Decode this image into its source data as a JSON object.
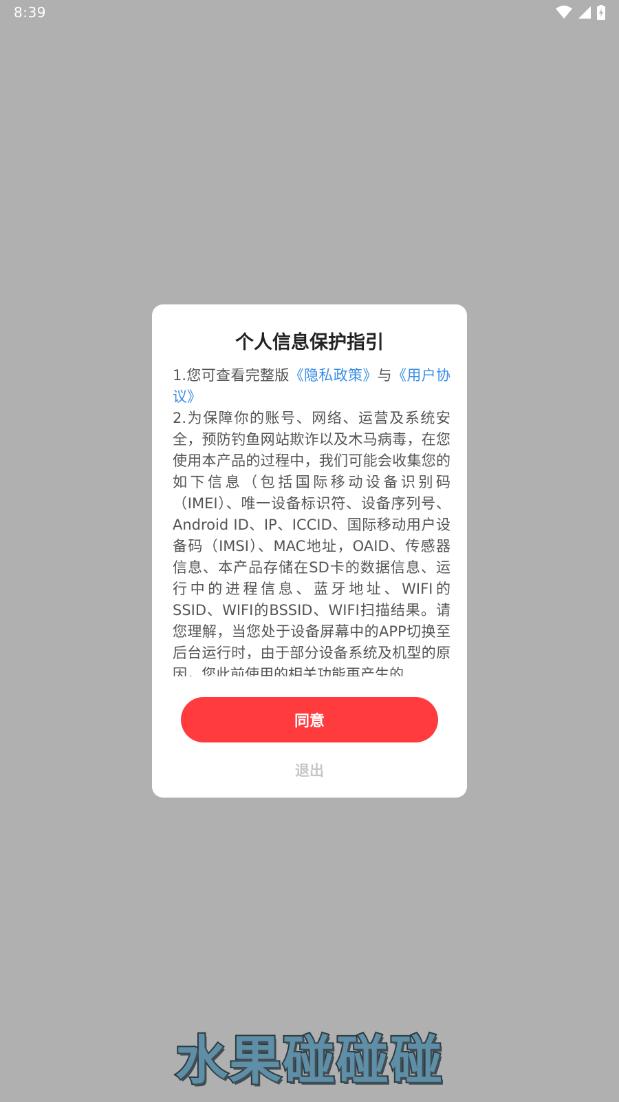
{
  "status_bar": {
    "time": "8:39",
    "icons": [
      "wifi-icon",
      "cellular-signal-icon",
      "battery-charging-icon"
    ]
  },
  "dialog": {
    "title": "个人信息保护指引",
    "line1": {
      "prefix": "1.您可查看完整版",
      "privacy_link": "《隐私政策》",
      "connector": "与",
      "terms_link": "《用户协议》"
    },
    "line2": "2.为保障你的账号、网络、运营及系统安全，预防钓鱼网站欺诈以及木马病毒，在您使用本产品的过程中，我们可能会收集您的如下信息（包括国际移动设备识别码（IMEI）、唯一设备标识符、设备序列号、Android ID、IP、ICCID、国际移动用户设备码（IMSI）、MAC地址，OAID、传感器信息、本产品存储在SD卡的数据信息、运行中的进程信息、蓝牙地址、WIFI的SSID、WIFI的BSSID、WIFI扫描结果。请您理解，当您处于设备屏幕中的APP切换至后台运行时，由于部分设备系统及机型的原因，您此前使用的相关功能再产生的",
    "agree_label": "同意",
    "exit_label": "退出"
  },
  "app_name": "水果碰碰碰",
  "colors": {
    "overlay": "#b0b0b0",
    "link": "#3a8ee6",
    "agree_button": "#ff3b3e",
    "exit_text": "#c6c6c6"
  }
}
